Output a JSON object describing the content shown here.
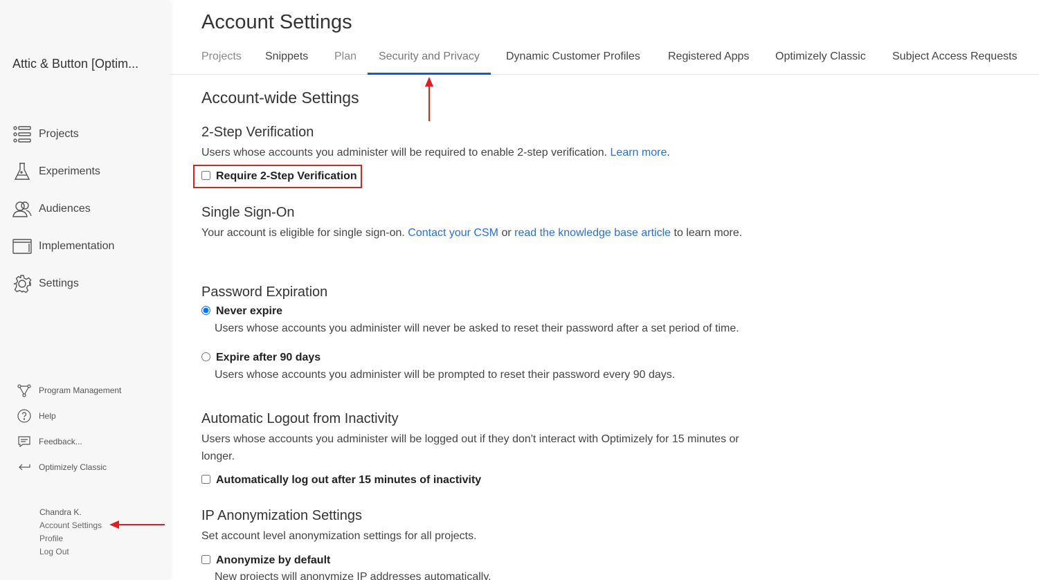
{
  "sidebar": {
    "account_name": "Attic & Button [Optim...",
    "nav": [
      {
        "label": "Projects",
        "icon": "projects-icon"
      },
      {
        "label": "Experiments",
        "icon": "flask-icon"
      },
      {
        "label": "Audiences",
        "icon": "audiences-icon"
      },
      {
        "label": "Implementation",
        "icon": "window-icon"
      },
      {
        "label": "Settings",
        "icon": "gear-icon"
      }
    ],
    "sub_nav": [
      {
        "label": "Program Management",
        "icon": "program-icon"
      },
      {
        "label": "Help",
        "icon": "help-icon"
      },
      {
        "label": "Feedback...",
        "icon": "feedback-icon"
      },
      {
        "label": "Optimizely Classic",
        "icon": "return-icon"
      }
    ],
    "user": {
      "name": "Chandra K.",
      "links": [
        "Account Settings",
        "Profile",
        "Log Out"
      ]
    }
  },
  "main": {
    "title": "Account Settings",
    "tabs": [
      {
        "label": "Projects",
        "state": "muted"
      },
      {
        "label": "Snippets",
        "state": "normal"
      },
      {
        "label": "Plan",
        "state": "muted"
      },
      {
        "label": "Security and Privacy",
        "state": "active"
      },
      {
        "label": "Dynamic Customer Profiles",
        "state": "normal"
      },
      {
        "label": "Registered Apps",
        "state": "normal"
      },
      {
        "label": "Optimizely Classic",
        "state": "normal"
      },
      {
        "label": "Subject Access Requests",
        "state": "normal"
      }
    ],
    "section_title": "Account-wide Settings",
    "two_step": {
      "heading": "2-Step Verification",
      "text": "Users whose accounts you administer will be required to enable 2-step verification.",
      "link": "Learn more",
      "after_link": ".",
      "checkbox_label": "Require 2-Step Verification",
      "checked": false
    },
    "sso": {
      "heading": "Single Sign-On",
      "text_1": "Your account is eligible for single sign-on.",
      "link_1": "Contact your CSM",
      "text_2": "or",
      "link_2": "read the knowledge base article",
      "text_3": "to learn more."
    },
    "password": {
      "heading": "Password Expiration",
      "options": [
        {
          "label": "Never expire",
          "desc": "Users whose accounts you administer will never be asked to reset their password after a set period of time.",
          "selected": true
        },
        {
          "label": "Expire after 90 days",
          "desc": "Users whose accounts you administer will be prompted to reset their password every 90 days.",
          "selected": false
        }
      ]
    },
    "logout": {
      "heading": "Automatic Logout from Inactivity",
      "text": "Users whose accounts you administer will be logged out if they don't interact with Optimizely for 15 minutes or longer.",
      "checkbox_label": "Automatically log out after 15 minutes of inactivity",
      "checked": false
    },
    "ip": {
      "heading": "IP Anonymization Settings",
      "text": "Set account level anonymization settings for all projects.",
      "checkbox_label": "Anonymize by default",
      "checked": false,
      "desc": "New projects will anonymize IP addresses automatically."
    }
  },
  "colors": {
    "accent": "#0a5be0",
    "link": "#2a6fd6",
    "annotation": "#e02020"
  }
}
